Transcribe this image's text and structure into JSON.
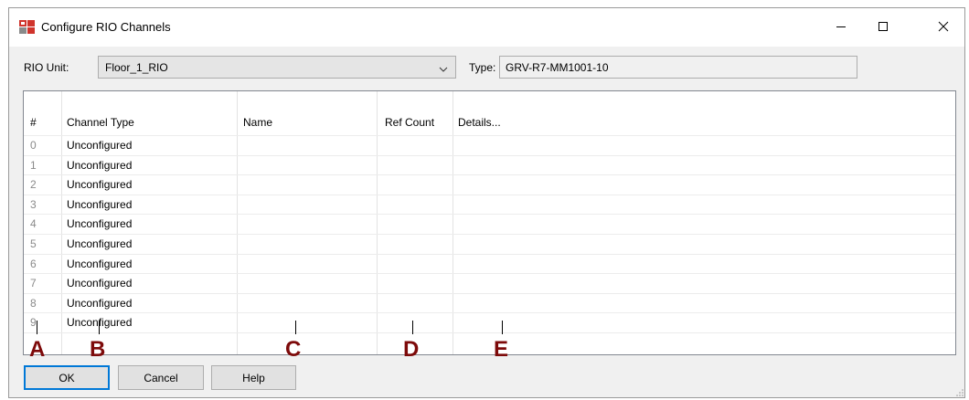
{
  "window": {
    "title": "Configure RIO Channels"
  },
  "rio": {
    "label": "RIO Unit:",
    "value": "Floor_1_RIO"
  },
  "type": {
    "label": "Type:",
    "value": "GRV-R7-MM1001-10"
  },
  "table": {
    "headers": [
      "#",
      "Channel Type",
      "Name",
      "Ref Count",
      "Details..."
    ],
    "rows": [
      {
        "num": "0",
        "channel_type": "Unconfigured"
      },
      {
        "num": "1",
        "channel_type": "Unconfigured"
      },
      {
        "num": "2",
        "channel_type": "Unconfigured"
      },
      {
        "num": "3",
        "channel_type": "Unconfigured"
      },
      {
        "num": "4",
        "channel_type": "Unconfigured"
      },
      {
        "num": "5",
        "channel_type": "Unconfigured"
      },
      {
        "num": "6",
        "channel_type": "Unconfigured"
      },
      {
        "num": "7",
        "channel_type": "Unconfigured"
      },
      {
        "num": "8",
        "channel_type": "Unconfigured"
      },
      {
        "num": "9",
        "channel_type": "Unconfigured"
      }
    ]
  },
  "markers": [
    "A",
    "B",
    "C",
    "D",
    "E"
  ],
  "buttons": {
    "ok": "OK",
    "cancel": "Cancel",
    "help": "Help"
  },
  "colors": {
    "marker": "#7d0a0a",
    "focus": "#0078d7"
  },
  "icons": [
    "app-icon",
    "minimize-icon",
    "maximize-icon",
    "close-icon",
    "chevron-down-icon",
    "resize-grip-icon"
  ]
}
